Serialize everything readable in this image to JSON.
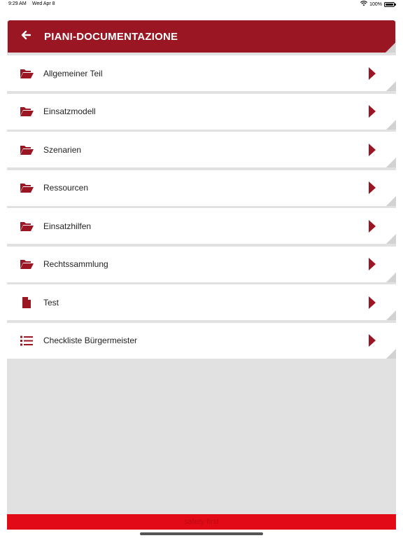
{
  "status_bar": {
    "time": "9:29 AM",
    "date": "Wed Apr 8",
    "battery": "100%"
  },
  "header": {
    "title": "PIANI-DOCUMENTAZIONE",
    "back_icon": "arrow-left-icon"
  },
  "list": {
    "items": [
      {
        "label": "Allgemeiner Teil",
        "icon": "folder-open-icon"
      },
      {
        "label": "Einsatzmodell",
        "icon": "folder-open-icon"
      },
      {
        "label": "Szenarien",
        "icon": "folder-open-icon"
      },
      {
        "label": "Ressourcen",
        "icon": "folder-open-icon"
      },
      {
        "label": "Einsatzhilfen",
        "icon": "folder-open-icon"
      },
      {
        "label": "Rechtssammlung",
        "icon": "folder-open-icon"
      },
      {
        "label": "Test",
        "icon": "document-icon"
      },
      {
        "label": "Checkliste Bürgermeister",
        "icon": "list-icon"
      }
    ]
  },
  "footer": {
    "text": "safety first"
  },
  "colors": {
    "header_red": "#9a1622",
    "icon_red": "#9a1622",
    "footer_red": "#e20a17",
    "background": "#e1e1e1"
  }
}
